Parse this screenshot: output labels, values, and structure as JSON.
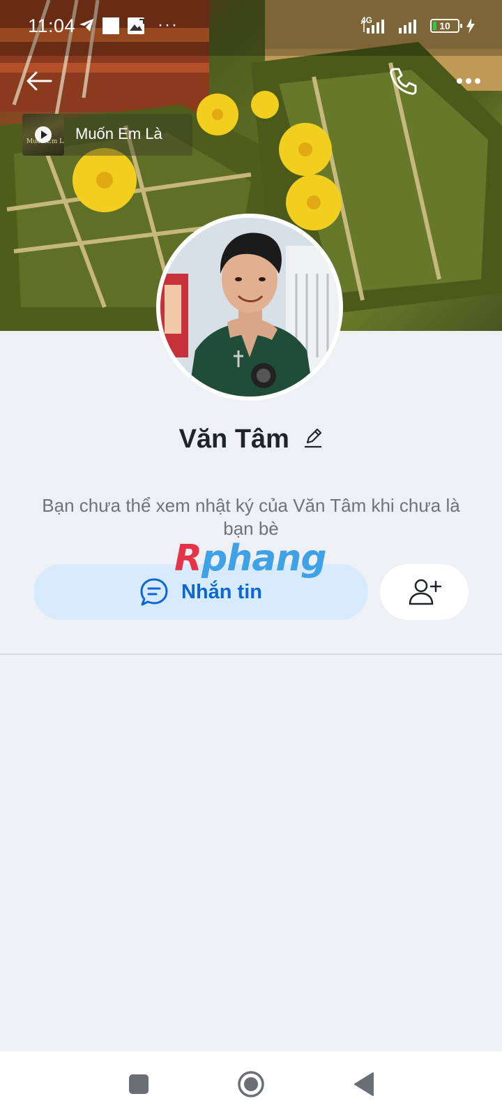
{
  "status_bar": {
    "time": "11:04",
    "network": "4G",
    "battery": "10"
  },
  "cover": {
    "music": {
      "title": "Muốn Em Là",
      "thumb_text": "Muốn Em Là..."
    }
  },
  "profile": {
    "name": "Văn Tâm",
    "notice": "Bạn chưa thể xem nhật ký của Văn Tâm khi chưa là bạn bè"
  },
  "actions": {
    "message_label": "Nhắn tin"
  },
  "watermark": {
    "first": "R",
    "rest": "phang"
  },
  "icons": {
    "back": "arrow-left-icon",
    "call": "phone-icon",
    "more": "more-horizontal-icon",
    "message": "chat-bubble-icon",
    "add_friend": "add-user-icon",
    "edit": "pencil-icon",
    "nav_recent": "square-icon",
    "nav_home": "circle-icon",
    "nav_back": "triangle-back-icon"
  },
  "colors": {
    "accent": "#0b67d6",
    "message_bg": "#d8eafd",
    "page_bg": "#eff0f4",
    "watermark_r": "#e4344a",
    "watermark_rest": "#3fa1e6"
  }
}
